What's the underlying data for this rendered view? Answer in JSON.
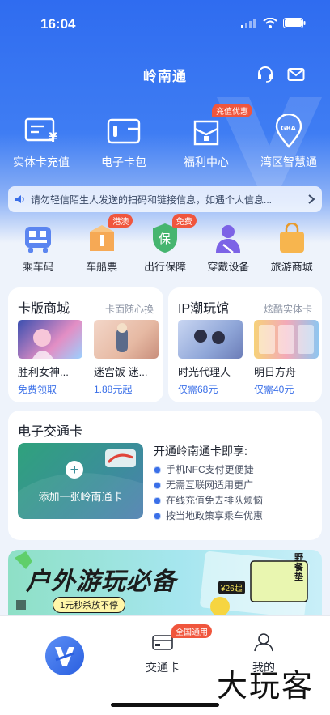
{
  "status_bar": {
    "time": "16:04"
  },
  "header": {
    "title": "岭南通"
  },
  "top_tiles": [
    {
      "label": "实体卡充值",
      "icon": "card-recharge-icon"
    },
    {
      "label": "电子卡包",
      "icon": "wallet-icon"
    },
    {
      "label": "福利中心",
      "icon": "gift-icon",
      "badge": "充值优惠"
    },
    {
      "label": "湾区智慧通",
      "icon": "gba-location-icon"
    }
  ],
  "notice": {
    "text": "请勿轻信陌生人发送的扫码和链接信息，如遇个人信息..."
  },
  "services": [
    {
      "label": "乘车码",
      "icon": "bus-qr-icon"
    },
    {
      "label": "车船票",
      "icon": "ticket-icon",
      "badge": "港澳"
    },
    {
      "label": "出行保障",
      "icon": "insurance-shield-icon",
      "badge": "免费",
      "shield_text": "保"
    },
    {
      "label": "穿戴设备",
      "icon": "wearable-icon"
    },
    {
      "label": "旅游商城",
      "icon": "shopping-bag-icon"
    }
  ],
  "card_mall": {
    "title": "卡版商城",
    "subtitle": "卡面随心换",
    "items": [
      {
        "name": "胜利女神...",
        "price": "免费领取"
      },
      {
        "name": "迷宫饭 迷...",
        "price": "1.88元起"
      }
    ]
  },
  "ip_hall": {
    "title": "IP潮玩馆",
    "subtitle": "炫酷实体卡",
    "items": [
      {
        "name": "时光代理人",
        "price": "仅需68元"
      },
      {
        "name": "明日方舟",
        "price": "仅需40元"
      }
    ]
  },
  "ecard": {
    "title": "电子交通卡",
    "add_label": "添加一张岭南通卡",
    "benefits_title": "开通岭南通卡即享:",
    "benefits": [
      "手机NFC支付更便捷",
      "无需互联网适用更广",
      "在线充值免去排队烦恼",
      "按当地政策享乘车优惠"
    ]
  },
  "banner": {
    "title": "户外游玩必备",
    "pill": "1元秒杀放不停",
    "tag": "野餐垫",
    "price_tag": "¥26起"
  },
  "tabbar": {
    "tabs": [
      {
        "label": "",
        "icon": "home-logo-icon"
      },
      {
        "label": "交通卡",
        "icon": "transit-card-icon",
        "badge": "全国通用"
      },
      {
        "label": "我的",
        "icon": "profile-icon"
      }
    ]
  },
  "watermark": "大玩客",
  "colors": {
    "primary": "#3a6fe8",
    "badge": "#f0563d",
    "hero_top": "#2f6cf0"
  }
}
